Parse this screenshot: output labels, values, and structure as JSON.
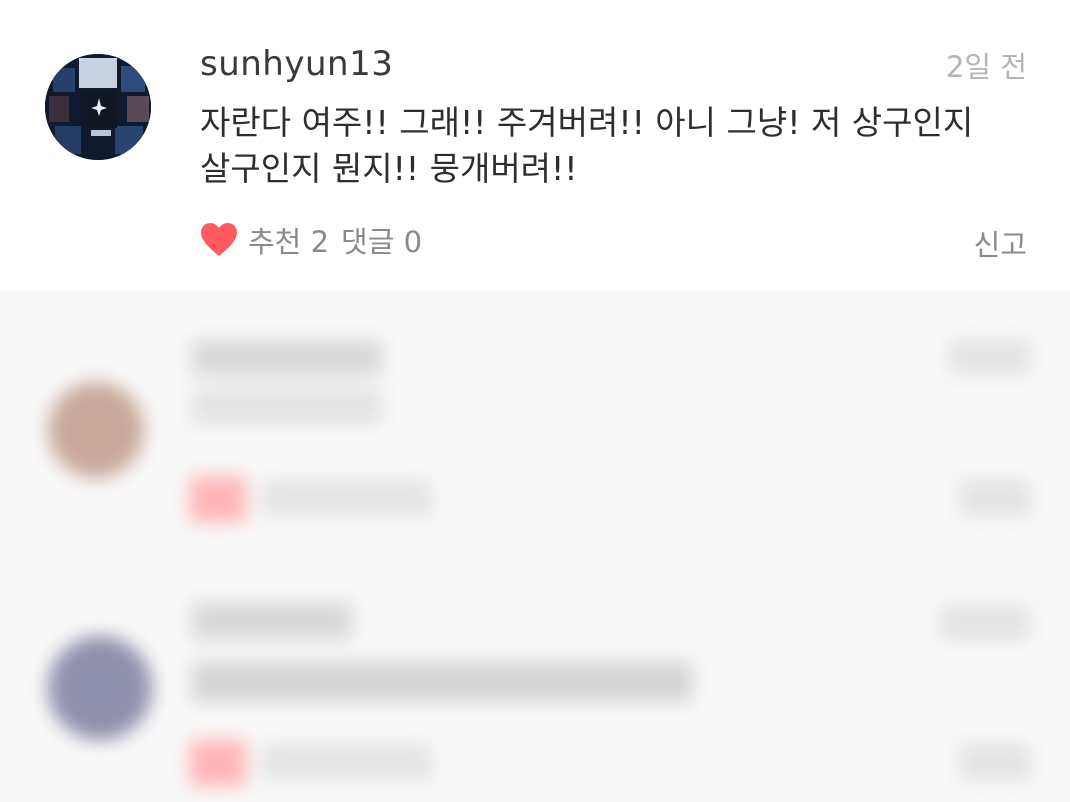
{
  "comment": {
    "username": "sunhyun13",
    "timestamp": "2일 전",
    "text": "자란다 여주!! 그래!!  주겨버려!! 아니 그냥! 저 상구인지\n살구인지 뭔지!! 뭉개버려!!",
    "likes_label": "추천 2",
    "replies_label": "댓글 0",
    "report_label": "신고",
    "heart_color": "#ff5a5f"
  },
  "colors": {
    "username": "#3a3a3a",
    "timestamp": "#b4b4b4",
    "meta": "#8a8a8a"
  }
}
